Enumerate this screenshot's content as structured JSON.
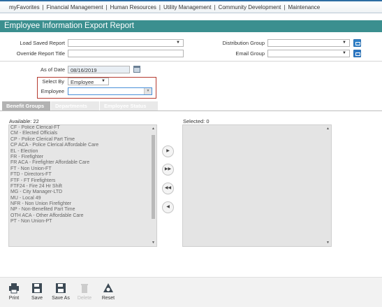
{
  "topnav": {
    "items": [
      "myFavorites",
      "Financial Management",
      "Human Resources",
      "Utility Management",
      "Community Development",
      "Maintenance"
    ],
    "separator": "|"
  },
  "title": "Employee Information Export Report",
  "form": {
    "load_saved_report_label": "Load Saved Report",
    "override_report_title_label": "Override Report Title",
    "distribution_group_label": "Distribution Group",
    "email_group_label": "Email Group",
    "as_of_date_label": "As of Date",
    "as_of_date_value": "08/16/2019",
    "select_by_label": "Select By",
    "select_by_value": "Employee",
    "employee_label": "Employee"
  },
  "tabs": [
    "Benefit Groups",
    "Departments",
    "Employee Status"
  ],
  "available": {
    "label": "Available: 22",
    "items": [
      "CF - Police Clerical-FT",
      "CM - Elected Officials",
      "CP - Police Clerical Part Time",
      "CP ACA - Police Clerical Affordable Care",
      "EL - Election",
      "FR - Firefighter",
      "FR ACA - Firefighter Affordable Care",
      "FT - Non Union-FT",
      "FTD - Directors-FT",
      "FTF - FT Firefighters",
      "FTF24 - Fire 24 Hr Shift",
      "MG - City Manager-LTD",
      "MU - Local 49",
      "NFR - Non Union Firefighter",
      "NP - Non-Benefited Part Time",
      "OTH ACA - Other Affordable Care",
      "PT - Non Union-PT"
    ]
  },
  "selected": {
    "label": "Selected: 0"
  },
  "toolbar": {
    "print": "Print",
    "save": "Save",
    "save_as": "Save As",
    "delete": "Delete",
    "reset": "Reset"
  },
  "colors": {
    "title_bar": "#3b8f8f",
    "highlight_border": "#b53b30",
    "active_tab": "#b3b3b3"
  }
}
